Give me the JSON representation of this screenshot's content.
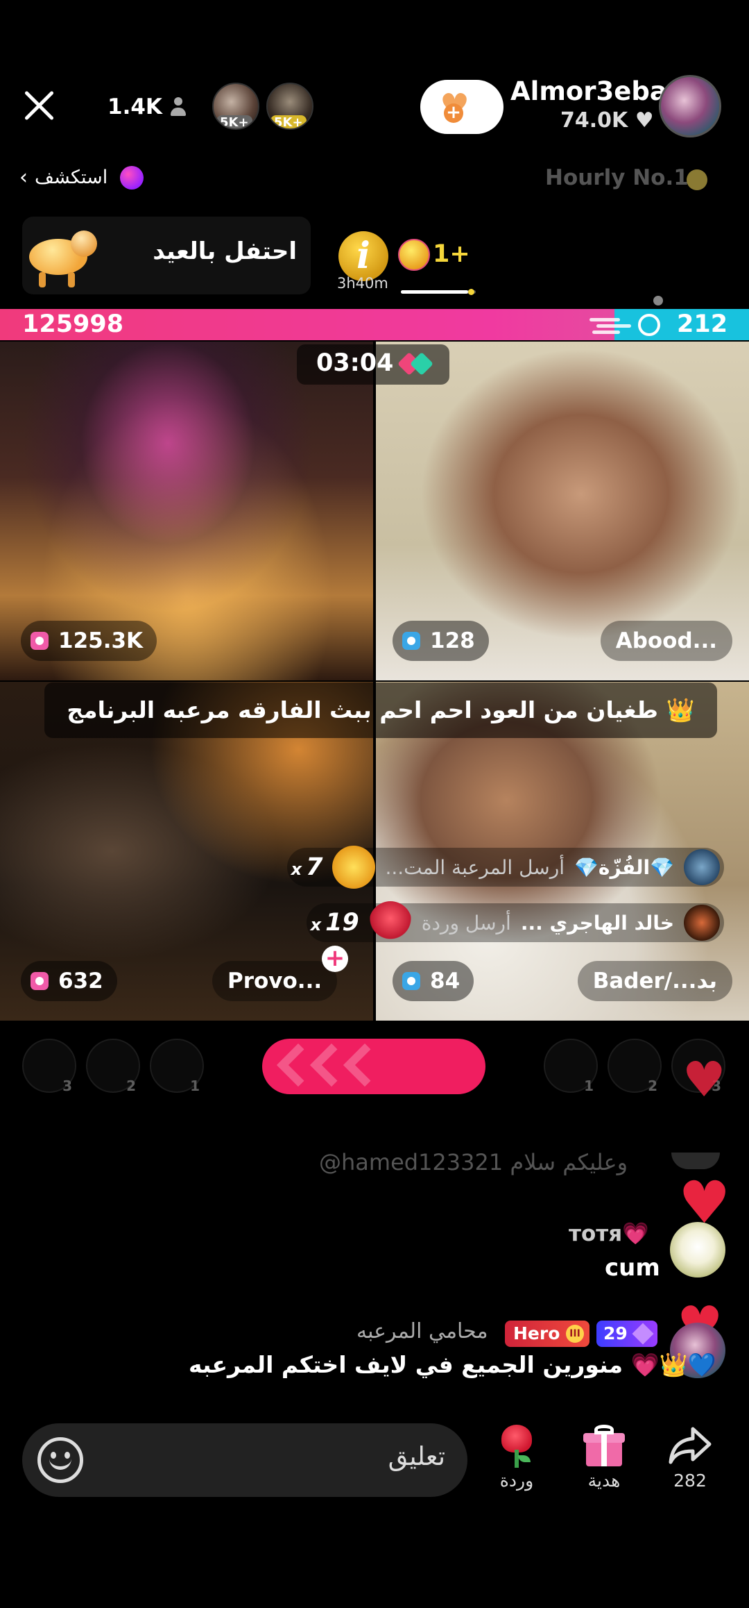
{
  "header": {
    "viewer_count": "1.4K",
    "top_viewers": [
      {
        "tag": "5K+"
      },
      {
        "tag": "5K+"
      }
    ],
    "host_name": "Almor3eba",
    "host_likes": "74.0K ♥"
  },
  "explore": {
    "label": "استكشف",
    "hourly_rank": "Hourly No.1"
  },
  "event": {
    "eid_label": "احتفل بالعيد",
    "timer_letter": "i",
    "timer_remaining": "3h40m",
    "bonus": "1+",
    "bonus_progress_percent": 90
  },
  "pk": {
    "left_score": "125998",
    "right_score": "212",
    "left_share_percent": 82
  },
  "round_timer": "03:04",
  "tiles": [
    {
      "stat": "125.3K"
    },
    {
      "stat": "128",
      "name": "Abood..."
    },
    {
      "stat": "632",
      "name": "Provo..."
    },
    {
      "stat": "84",
      "name": "Bader/...بد"
    }
  ],
  "announcement": "طغيان من العود احم احم ببث الفارقه مرعبه البرنامج 👑",
  "gift_feed": [
    {
      "user": "💎الفُزّة💎",
      "action": "أرسل المرعبة المت...",
      "count": "7"
    },
    {
      "user": "خالد الهاجري ...",
      "action": "أرسل وردة",
      "count": "19"
    }
  ],
  "battle_ranks": {
    "left": [
      "3",
      "2",
      "1"
    ],
    "right": [
      "1",
      "2",
      "3"
    ]
  },
  "comments": {
    "faded": "@hamed123321 وعليكم سلام",
    "items": [
      {
        "user": "тотя💗",
        "text": "cum"
      },
      {
        "user": "محامي المرعبه",
        "badge": "Hero",
        "level": "29",
        "text": "منورين الجميع في لايف اختكم المرعبه 💗👑💙"
      }
    ]
  },
  "bottom": {
    "input_placeholder": "تعليق",
    "rose_label": "وردة",
    "gift_label": "هدية",
    "share_count": "282"
  },
  "colors": {
    "pk_red": "#f03a7c",
    "pk_blue": "#18c2de",
    "battle_button": "#f01e60",
    "heart": "#e8243f"
  },
  "icons": [
    "close-icon",
    "viewer-icon",
    "heart-icon",
    "chevron-left-icon",
    "rose-icon",
    "gift-icon",
    "share-icon",
    "emoji-icon"
  ]
}
